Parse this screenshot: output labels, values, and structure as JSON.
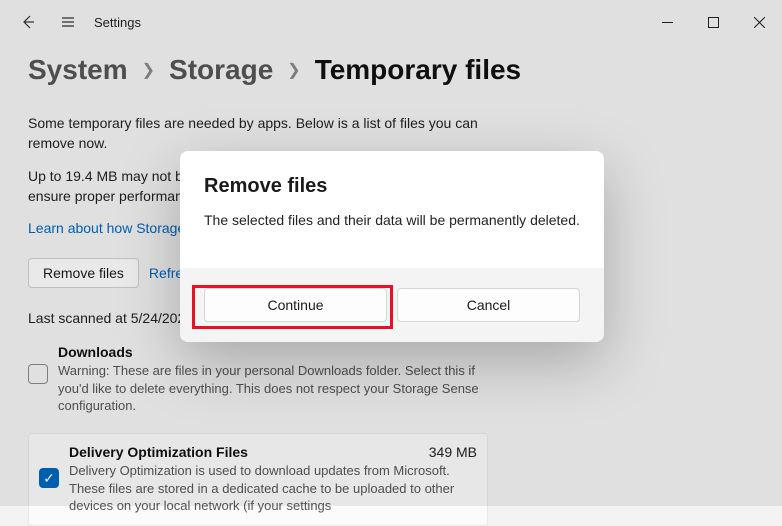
{
  "titlebar": {
    "app_name": "Settings"
  },
  "breadcrumb": {
    "part1": "System",
    "part2": "Storage",
    "current": "Temporary files"
  },
  "intro": {
    "p1": "Some temporary files are needed by apps. Below is a list of files you can remove now.",
    "p2": "Up to 19.4 MB may not be reclaimable. Windows reserves some storage to ensure proper performance and successful updates of your device.",
    "link": "Learn about how Storage Sense works"
  },
  "actions": {
    "remove": "Remove files",
    "refresh": "Refresh"
  },
  "last_scanned": "Last scanned at 5/24/2022 12:51 PM",
  "files": [
    {
      "title": "Downloads",
      "size": "",
      "checked": false,
      "desc": "Warning: These are files in your personal Downloads folder. Select this if you'd like to delete everything. This does not respect your Storage Sense configuration."
    },
    {
      "title": "Delivery Optimization Files",
      "size": "349 MB",
      "checked": true,
      "desc": "Delivery Optimization is used to download updates from Microsoft. These files are stored in a dedicated cache to be uploaded to other devices on your local network (if your settings"
    }
  ],
  "dialog": {
    "title": "Remove files",
    "message": "The selected files and their data will be permanently deleted.",
    "continue": "Continue",
    "cancel": "Cancel"
  }
}
